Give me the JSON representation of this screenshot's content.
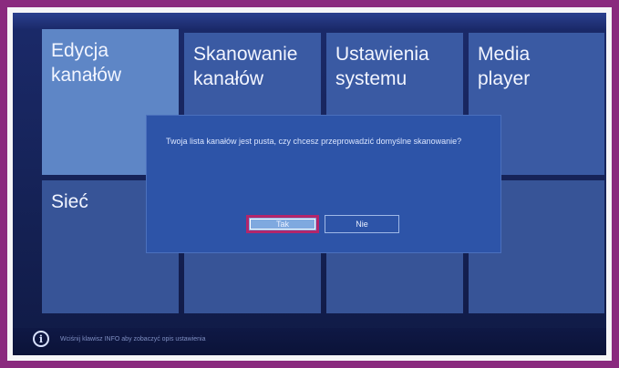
{
  "menu": {
    "tiles": [
      {
        "label": "Edycja\nkanałów"
      },
      {
        "label": "Skanowanie\nkanałów"
      },
      {
        "label": "Ustawienia\nsystemu"
      },
      {
        "label": "Media\nplayer"
      },
      {
        "label": "Sieć"
      },
      {
        "label": ""
      },
      {
        "label": ""
      },
      {
        "label": ""
      }
    ]
  },
  "dialog": {
    "message": "Twoja lista kanałów jest pusta, czy chcesz przeprowadzić domyślne skanowanie?",
    "yes_label": "Tak",
    "no_label": "Nie"
  },
  "footer": {
    "info_icon": "info-icon",
    "hint": "Wciśnij klawisz INFO aby zobaczyć opis ustawienia"
  },
  "colors": {
    "frame": "#8a2a7e",
    "tile": "#3a5aa3",
    "tile_selected": "#5e86c6",
    "dialog": "#2d54a8",
    "highlight_border": "#b3266b"
  }
}
